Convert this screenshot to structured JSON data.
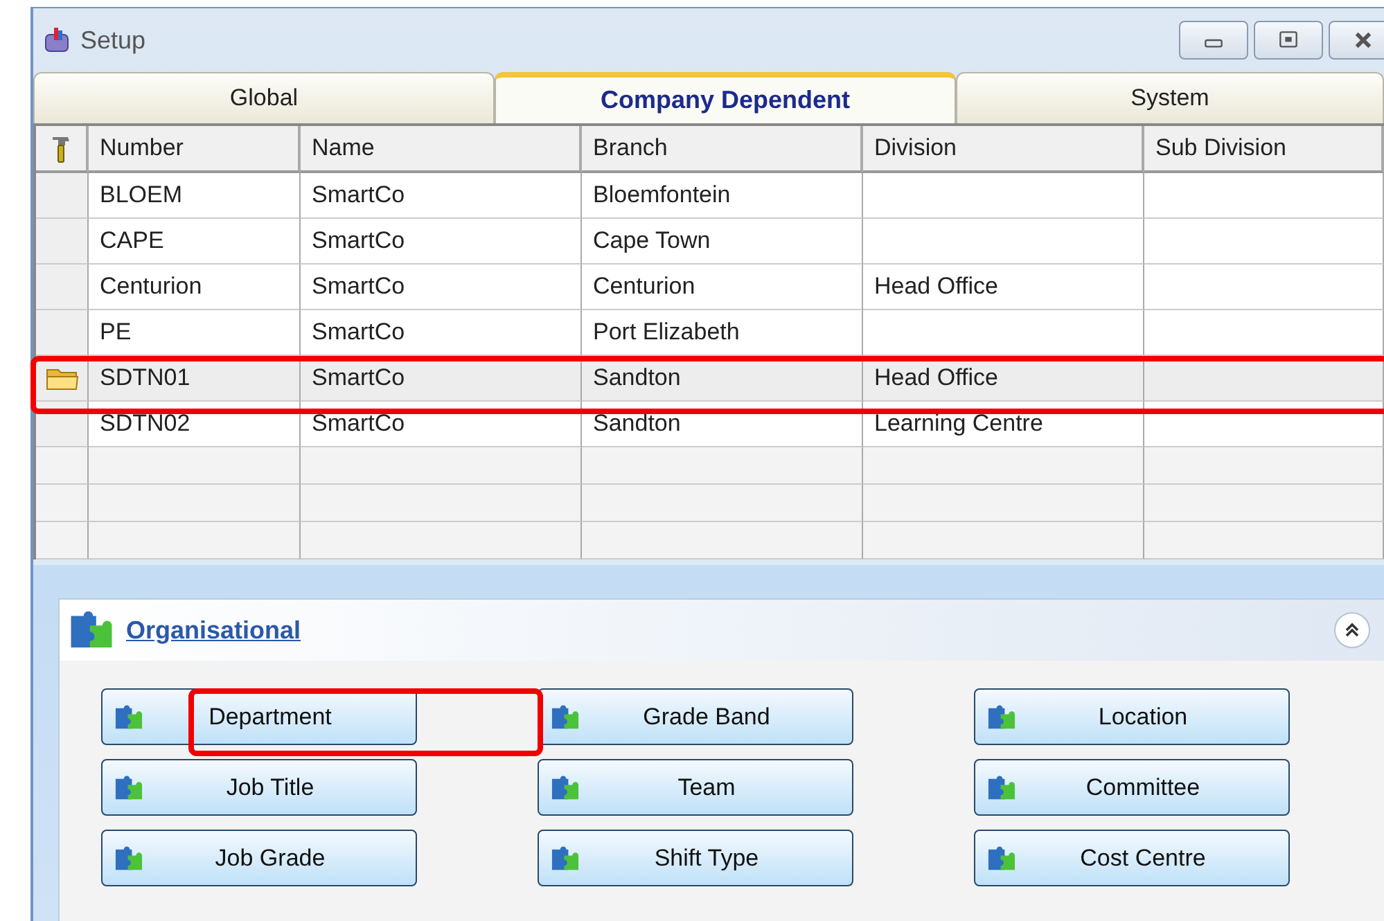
{
  "window": {
    "title": "Setup"
  },
  "tabs": [
    {
      "label": "Global",
      "selected": false
    },
    {
      "label": "Company Dependent",
      "selected": true
    },
    {
      "label": "System",
      "selected": false
    }
  ],
  "table": {
    "columns": [
      "Number",
      "Name",
      "Branch",
      "Division",
      "Sub Division"
    ],
    "rows": [
      {
        "cells": [
          "BLOEM",
          "SmartCo",
          "Bloemfontein",
          "",
          ""
        ],
        "selected": false
      },
      {
        "cells": [
          "CAPE",
          "SmartCo",
          "Cape Town",
          "",
          ""
        ],
        "selected": false
      },
      {
        "cells": [
          "Centurion",
          "SmartCo",
          "Centurion",
          "Head Office",
          ""
        ],
        "selected": false
      },
      {
        "cells": [
          "PE",
          "SmartCo",
          "Port Elizabeth",
          "",
          ""
        ],
        "selected": false
      },
      {
        "cells": [
          "SDTN01",
          "SmartCo",
          "Sandton",
          "Head Office",
          ""
        ],
        "selected": true
      },
      {
        "cells": [
          "SDTN02",
          "SmartCo",
          "Sandton",
          "Learning Centre",
          ""
        ],
        "selected": false
      }
    ]
  },
  "panel": {
    "title": "Organisational",
    "expanded": true,
    "buttons": [
      "Department",
      "Grade Band",
      "Location",
      "Job Title",
      "Team",
      "Committee",
      "Job Grade",
      "Shift Type",
      "Cost Centre"
    ]
  }
}
